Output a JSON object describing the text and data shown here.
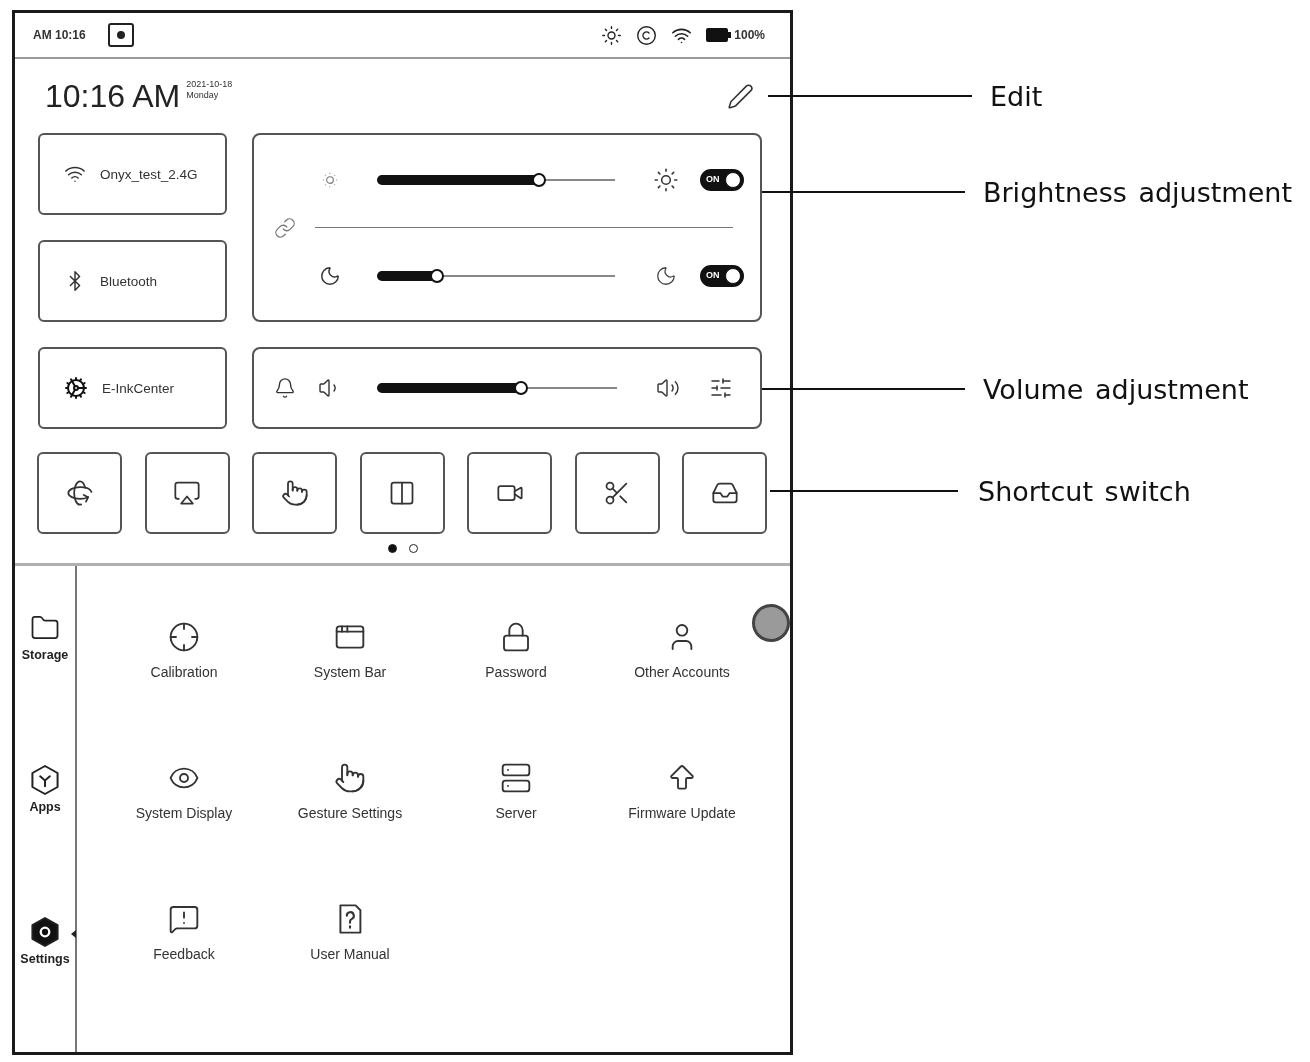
{
  "status_bar": {
    "time": "AM 10:16",
    "battery": "100%"
  },
  "header": {
    "time": "10:16 AM",
    "date": "2021-10-18",
    "weekday": "Monday"
  },
  "quick_tiles": [
    {
      "label": "Onyx_test_2.4G"
    },
    {
      "label": "Bluetooth"
    },
    {
      "label": "E-InkCenter"
    }
  ],
  "light": {
    "rows": [
      {
        "level": 0.68,
        "on": true,
        "switch_label": "ON"
      },
      {
        "level": 0.25,
        "on": true,
        "switch_label": "ON"
      }
    ]
  },
  "volume": {
    "level": 0.6
  },
  "page_dots": [
    {
      "selected": true
    },
    {
      "selected": false
    }
  ],
  "sidebar": [
    {
      "label": "Storage",
      "selected": false
    },
    {
      "label": "Apps",
      "selected": false
    },
    {
      "label": "Settings",
      "selected": true
    }
  ],
  "settings_items": [
    "Calibration",
    "System Bar",
    "Password",
    "Other Accounts",
    "System Display",
    "Gesture Settings",
    "Server",
    "Firmware Update",
    "Feedback",
    "User Manual"
  ],
  "callouts": [
    "Edit",
    "Brightness adjustment",
    "Volume adjustment",
    "Shortcut switch"
  ]
}
